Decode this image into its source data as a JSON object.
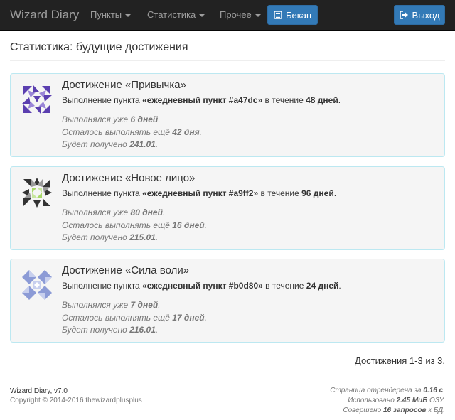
{
  "navbar": {
    "brand": "Wizard Diary",
    "menu": [
      "Пункты",
      "Статистика",
      "Прочее"
    ],
    "backup_label": "Бекап",
    "logout_label": "Выход"
  },
  "page": {
    "title": "Статистика: будущие достижения"
  },
  "achievements": [
    {
      "name": "Достижение «Привычка»",
      "desc_prefix": "Выполнение пункта ",
      "item": "«ежедневный пункт #a47dc»",
      "desc_mid": " в течение ",
      "days": "48 дней",
      "desc_suffix": ".",
      "done_prefix": "Выполнялся уже ",
      "done": "6 дней",
      "left_prefix": "Осталось выполнять ещё ",
      "left": "42 дня",
      "date_prefix": "Будет получено ",
      "date": "241.01",
      "end": ".",
      "emblem_color": "#5b3fb0"
    },
    {
      "name": "Достижение «Новое лицо»",
      "desc_prefix": "Выполнение пункта ",
      "item": "«ежедневный пункт #a9ff2»",
      "desc_mid": " в течение ",
      "days": "96 дней",
      "desc_suffix": ".",
      "done_prefix": "Выполнялся уже ",
      "done": "80 дней",
      "left_prefix": "Осталось выполнять ещё ",
      "left": "16 дней",
      "date_prefix": "Будет получено ",
      "date": "215.01",
      "end": ".",
      "emblem_color": "#333333"
    },
    {
      "name": "Достижение «Сила воли»",
      "desc_prefix": "Выполнение пункта ",
      "item": "«ежедневный пункт #b0d80»",
      "desc_mid": " в течение ",
      "days": "24 дней",
      "desc_suffix": ".",
      "done_prefix": "Выполнялся уже ",
      "done": "7 дней",
      "left_prefix": "Осталось выполнять ещё ",
      "left": "17 дней",
      "date_prefix": "Будет получено ",
      "date": "216.01",
      "end": ".",
      "emblem_color": "#8c9bd6"
    }
  ],
  "pager": {
    "info": "Достижения 1-3 из 3."
  },
  "footer": {
    "app": "Wizard Diary, v7.0",
    "copyright": "Copyright © 2014-2016 thewizardplusplus",
    "render_prefix": "Страница отрендерена за ",
    "render_time": "0.16 с",
    "render_suffix": ".",
    "mem_prefix": "Использовано ",
    "mem_value": "2.45 МиБ",
    "mem_suffix": " ОЗУ.",
    "db_prefix": "Совершено ",
    "db_value": "16 запросов",
    "db_suffix": " к БД."
  }
}
